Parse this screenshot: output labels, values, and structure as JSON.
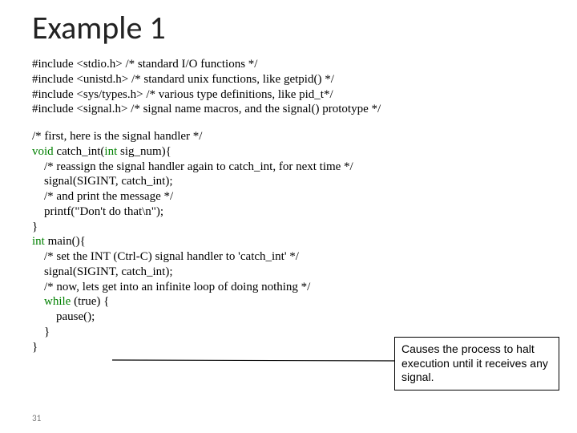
{
  "title": "Example 1",
  "code": {
    "inc1": "#include <stdio.h>      /* standard I/O functions */",
    "inc2": "#include <unistd.h>    /* standard unix functions, like getpid() */",
    "inc3": "#include <sys/types.h> /* various type definitions, like pid_t*/",
    "inc4": "#include <signal.h>    /* signal name macros, and the signal() prototype */",
    "c1": "/* first, here is the signal handler */",
    "c2a": "void",
    "c2b": " catch_int(",
    "c2c": "int",
    "c2d": " sig_num){",
    "c3": "    /* reassign the signal handler again to catch_int, for next time */",
    "c4": "    signal(SIGINT, catch_int);",
    "c5": "    /* and print the message */",
    "c6": "    printf(\"Don't do that\\n\");",
    "c7": "}",
    "c8a": "int",
    "c8b": " main(){",
    "c9": "    /* set the INT (Ctrl-C) signal handler to 'catch_int' */",
    "c10": "    signal(SIGINT, catch_int);",
    "c11": "    /* now, lets get into an infinite loop of doing nothing */",
    "c12a": "    ",
    "c12b": "while",
    "c12c": " (true) {",
    "c13": "        pause();",
    "c14": "    }",
    "c15": "}"
  },
  "callout": "Causes the process to halt execution until it receives any signal.",
  "pagenum": "31"
}
